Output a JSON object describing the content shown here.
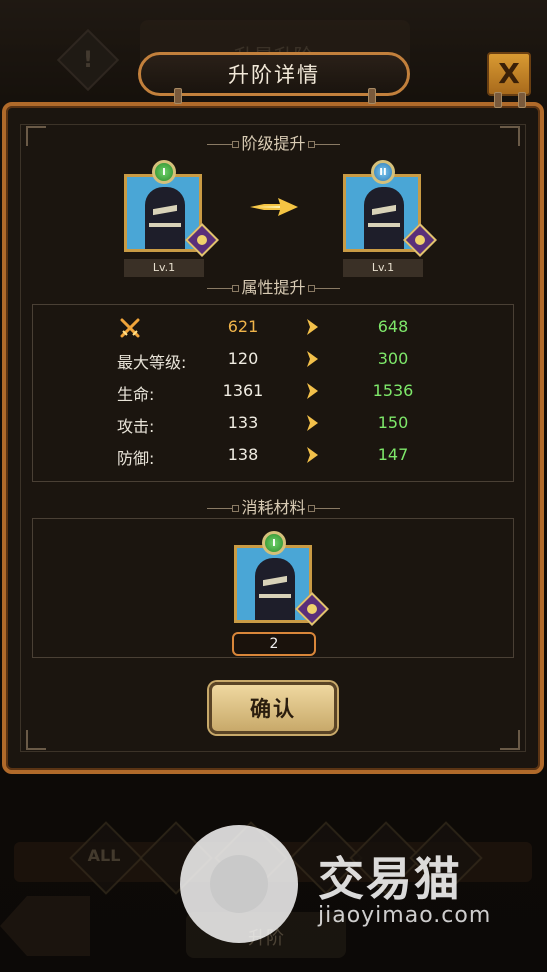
{
  "background": {
    "bg_title": "升星升阶",
    "filter_all_label": "ALL",
    "bottom_button_label": "升阶"
  },
  "dialog": {
    "title": "升阶详情",
    "close_label": "X",
    "rank_section": {
      "title": "阶级提升",
      "from": {
        "rank": "I",
        "level": "Lv.1"
      },
      "to": {
        "rank": "II",
        "level": "Lv.1"
      }
    },
    "attributes_section": {
      "title": "属性提升",
      "rows": [
        {
          "label": "",
          "icon": "crossed-swords-icon",
          "from": "621",
          "to": "648"
        },
        {
          "label": "最大等级:",
          "from": "120",
          "to": "300"
        },
        {
          "label": "生命:",
          "from": "1361",
          "to": "1536"
        },
        {
          "label": "攻击:",
          "from": "133",
          "to": "150"
        },
        {
          "label": "防御:",
          "from": "138",
          "to": "147"
        }
      ]
    },
    "materials_section": {
      "title": "消耗材料",
      "item": {
        "rank": "I",
        "count": "2"
      }
    },
    "confirm_label": "确认"
  },
  "watermark": {
    "brand": "交易猫",
    "domain": "jiaoyimao.com"
  },
  "colors": {
    "accent_orange": "#b06a2a",
    "increase_green": "#7ee86a",
    "power_orange": "#f0b44a"
  }
}
